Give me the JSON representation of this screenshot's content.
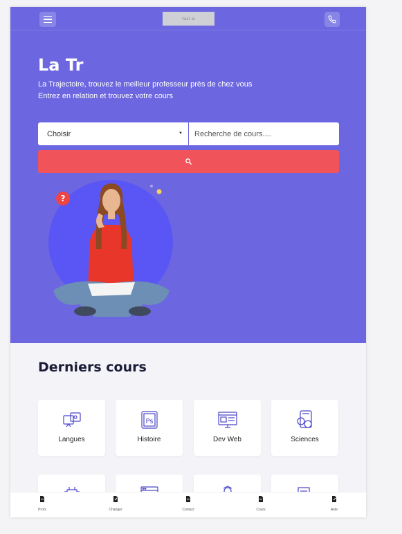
{
  "header": {
    "logo_text": "taxi ai",
    "menu_icon": "hamburger-menu-icon",
    "phone_icon": "phone-icon"
  },
  "hero": {
    "title": "La Tr",
    "subtitle_line1": "La Trajectoire, trouvez le meilleur professeur près de chez vous",
    "subtitle_line2": "Entrez en relation et trouvez votre cours",
    "bg_color": "#6c67e0"
  },
  "search": {
    "select_value": "Choisir",
    "input_placeholder": "Recherche de cours....",
    "button_icon": "search-icon",
    "button_color": "#f0545a"
  },
  "courses": {
    "title": "Derniers cours",
    "items": [
      {
        "label": "Langues",
        "icon": "languages-icon"
      },
      {
        "label": "Histoire",
        "icon": "history-icon"
      },
      {
        "label": "Dev Web",
        "icon": "web-dev-icon"
      },
      {
        "label": "Sciences",
        "icon": "sciences-icon"
      },
      {
        "label": "",
        "icon": "chip-icon"
      },
      {
        "label": "",
        "icon": "browser-icon"
      },
      {
        "label": "",
        "icon": "person-icon"
      },
      {
        "label": "",
        "icon": "documents-icon"
      }
    ]
  },
  "bottom_nav": [
    {
      "label": "Profs",
      "icon": "document-icon"
    },
    {
      "label": "Changer",
      "icon": "edit-document-icon"
    },
    {
      "label": "Contact",
      "icon": "document-icon"
    },
    {
      "label": "Cours",
      "icon": "document-icon"
    },
    {
      "label": "Aide",
      "icon": "edit-document-icon"
    }
  ]
}
